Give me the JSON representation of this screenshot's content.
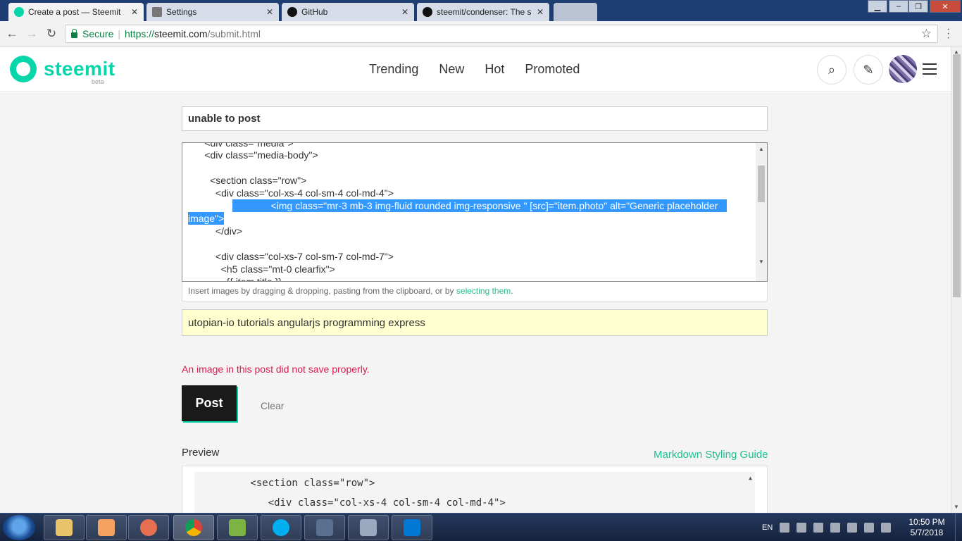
{
  "browser": {
    "tabs": [
      {
        "title": "Create a post — Steemit",
        "active": true
      },
      {
        "title": "Settings",
        "active": false
      },
      {
        "title": "GitHub",
        "active": false
      },
      {
        "title": "steemit/condenser: The s",
        "active": false
      }
    ],
    "secure_label": "Secure",
    "url_proto": "https://",
    "url_host": "steemit.com",
    "url_path": "/submit.html"
  },
  "header": {
    "logo_text": "steemit",
    "beta_label": "beta",
    "nav": [
      "Trending",
      "New",
      "Hot",
      "Promoted"
    ]
  },
  "form": {
    "title_value": "unable to post",
    "editor_lines": [
      "      <div class=\"media\">",
      "      <div class=\"media-body\">",
      "",
      "        <section class=\"row\">",
      "          <div class=\"col-xs-4 col-sm-4 col-md-4\">",
      "              <img class=\"mr-3 mb-3 img-fluid rounded img-responsive \" [src]=\"item.photo\" alt=\"Generic placeholder ",
      "image\">",
      "          </div>",
      "",
      "          <div class=\"col-xs-7 col-sm-7 col-md-7\">",
      "            <h5 class=\"mt-0 clearfix\">",
      "              {{ item.title }}"
    ],
    "dropzone_text": "Insert images by dragging & dropping, pasting from the clipboard, or by ",
    "dropzone_link": "selecting them",
    "dropzone_end": ".",
    "tags_value": "utopian-io tutorials angularjs programming express",
    "error_text": "An image in this post did not save properly.",
    "post_label": "Post",
    "clear_label": "Clear"
  },
  "preview": {
    "label": "Preview",
    "guide_link": "Markdown Styling Guide",
    "code_lines": [
      "        <section class=\"row\">",
      "           <div class=\"col-xs-4 col-sm-4 col-md-4\">"
    ]
  },
  "taskbar": {
    "lang": "EN",
    "time": "10:50 PM",
    "date": "5/7/2018"
  },
  "colors": {
    "brand": "#06d6a9",
    "error": "#e01a4f",
    "selection": "#3399ff"
  }
}
